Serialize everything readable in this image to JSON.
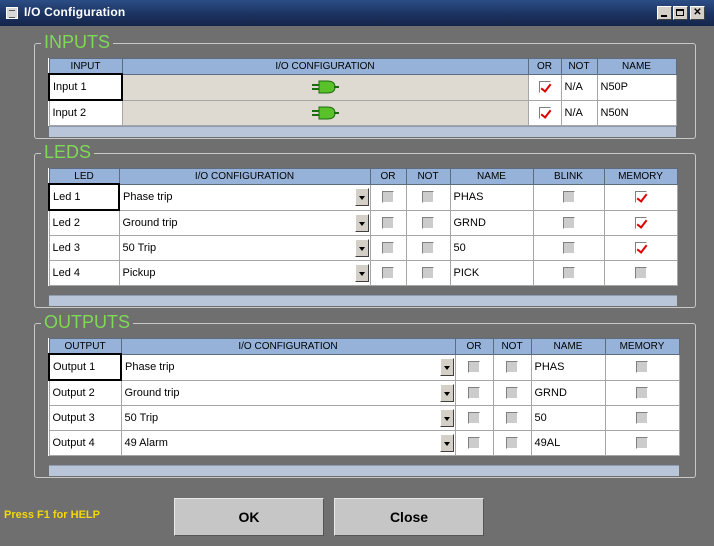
{
  "window": {
    "title": "I/O Configuration"
  },
  "inputs": {
    "legend": "INPUTS",
    "headers": [
      "INPUT",
      "I/O CONFIGURATION",
      "OR",
      "NOT",
      "NAME"
    ],
    "rows": [
      {
        "input": "Input 1",
        "config_icon": "plug-icon",
        "or": true,
        "not": "N/A",
        "name": "N50P"
      },
      {
        "input": "Input 2",
        "config_icon": "plug-icon",
        "or": true,
        "not": "N/A",
        "name": "N50N"
      }
    ]
  },
  "leds": {
    "legend": "LEDS",
    "headers": [
      "LED",
      "I/O CONFIGURATION",
      "OR",
      "NOT",
      "NAME",
      "BLINK",
      "MEMORY"
    ],
    "rows": [
      {
        "led": "Led 1",
        "config": "Phase trip",
        "or": false,
        "not": false,
        "name": "PHAS",
        "blink": false,
        "memory": true
      },
      {
        "led": "Led 2",
        "config": "Ground trip",
        "or": false,
        "not": false,
        "name": "GRND",
        "blink": false,
        "memory": true
      },
      {
        "led": "Led 3",
        "config": "50 Trip",
        "or": false,
        "not": false,
        "name": "50",
        "blink": false,
        "memory": true
      },
      {
        "led": "Led 4",
        "config": "Pickup",
        "or": false,
        "not": false,
        "name": "PICK",
        "blink": false,
        "memory": false
      }
    ]
  },
  "outputs": {
    "legend": "OUTPUTS",
    "headers": [
      "OUTPUT",
      "I/O CONFIGURATION",
      "OR",
      "NOT",
      "NAME",
      "MEMORY"
    ],
    "rows": [
      {
        "output": "Output 1",
        "config": "Phase trip",
        "or": false,
        "not": false,
        "name": "PHAS",
        "memory": false
      },
      {
        "output": "Output 2",
        "config": "Ground trip",
        "or": false,
        "not": false,
        "name": "GRND",
        "memory": false
      },
      {
        "output": "Output 3",
        "config": "50 Trip",
        "or": false,
        "not": false,
        "name": "50",
        "memory": false
      },
      {
        "output": "Output 4",
        "config": "49 Alarm",
        "or": false,
        "not": false,
        "name": "49AL",
        "memory": false
      }
    ]
  },
  "footer": {
    "help": "Press F1 for HELP",
    "ok_label": "OK",
    "close_label": "Close"
  },
  "colors": {
    "legend": "#7ed957",
    "header": "#96b2d8",
    "help": "#f5d70a",
    "check": "#e00000",
    "plug": "#59c22a"
  }
}
